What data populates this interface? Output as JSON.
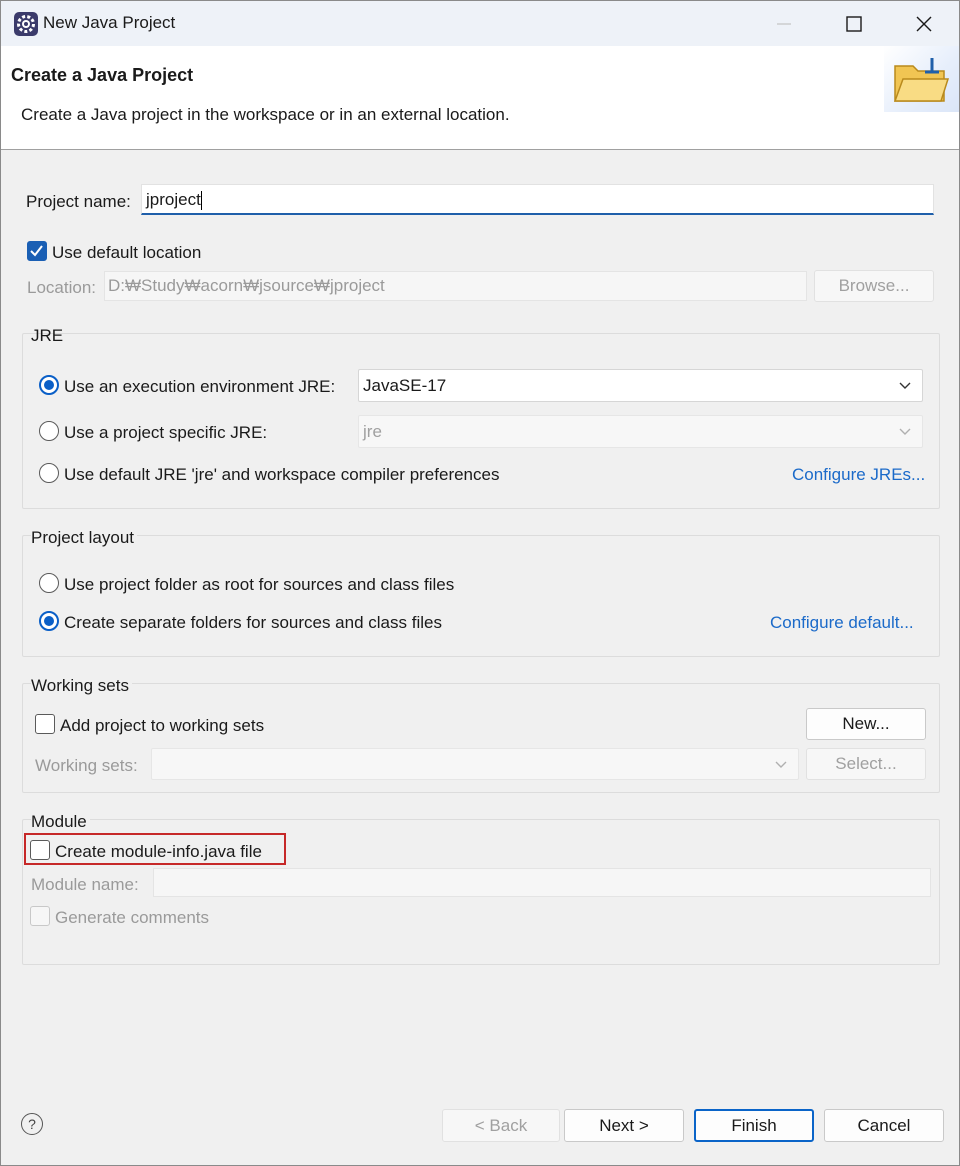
{
  "window": {
    "title": "New Java Project"
  },
  "header": {
    "title": "Create a Java Project",
    "description": "Create a Java project in the workspace or in an external location."
  },
  "project": {
    "name_label": "Project name:",
    "name_value": "jproject",
    "use_default_label": "Use default location",
    "use_default_checked": true,
    "location_label": "Location:",
    "location_value": "D:₩Study₩acorn₩jsource₩jproject",
    "browse_label": "Browse..."
  },
  "jre": {
    "group_title": "JRE",
    "option_exec_env": "Use an execution environment JRE:",
    "exec_env_value": "JavaSE-17",
    "option_specific": "Use a project specific JRE:",
    "specific_value": "jre",
    "option_default": "Use default JRE 'jre' and workspace compiler preferences",
    "configure_link": "Configure JREs..."
  },
  "layout": {
    "group_title": "Project layout",
    "option_root": "Use project folder as root for sources and class files",
    "option_separate": "Create separate folders for sources and class files",
    "configure_link": "Configure default..."
  },
  "working_sets": {
    "group_title": "Working sets",
    "add_label": "Add project to working sets",
    "new_button": "New...",
    "sets_label": "Working sets:",
    "select_button": "Select..."
  },
  "module": {
    "group_title": "Module",
    "create_label": "Create module-info.java file",
    "name_label": "Module name:",
    "comments_label": "Generate comments"
  },
  "footer": {
    "help_glyph": "?",
    "back_label": "< Back",
    "next_label": "Next >",
    "finish_label": "Finish",
    "cancel_label": "Cancel"
  },
  "icons": {
    "app": "eclipse-gear-icon",
    "minimize": "minimize-icon",
    "maximize": "maximize-icon",
    "close": "close-icon",
    "wizard": "folder-wizard-icon",
    "chevron": "chevron-down-icon"
  }
}
